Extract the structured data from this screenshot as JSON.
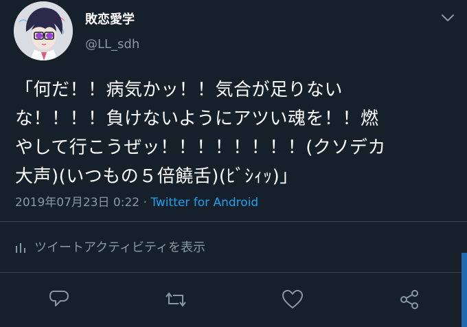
{
  "tweet": {
    "display_name": "敗恋愛学",
    "handle": "@LL_sdh",
    "text": "「何だ！！病気かッ！！気合が足りない\nな！！！！負けないようにアツい魂を！！燃\nやして行こうぜッ！！！！！！！！(クソデカ\n大声)(いつもの５倍饒舌)(ﾋﾞｼｨｯ)」",
    "timestamp": "2019年07月23日 0:22",
    "separator": " · ",
    "source": "Twitter for Android",
    "activity_label": "ツイートアクティビティを表示"
  },
  "icons": {
    "more": "chevron-down-icon",
    "activity": "bar-chart-icon",
    "reply": "reply-icon",
    "retweet": "retweet-icon",
    "like": "heart-icon",
    "share": "share-icon"
  },
  "colors": {
    "background": "#15202b",
    "text": "#ffffff",
    "muted": "#8899a6",
    "link": "#1da1f2",
    "divider": "#38444d"
  }
}
